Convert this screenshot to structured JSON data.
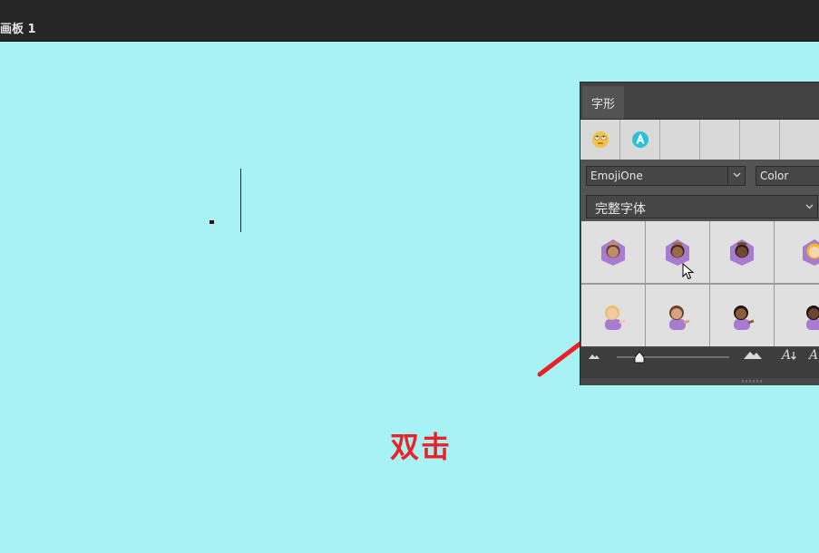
{
  "document": {
    "artboard_label": "画板 1"
  },
  "annotation": {
    "text": "双击",
    "color": "#e8242a"
  },
  "glyphs_panel": {
    "tab_label": "字形",
    "recent_glyphs": [
      "rolling-eyes-emoji",
      "letter-a-circle-emoji",
      "",
      "",
      ""
    ],
    "font_family": "EmojiOne",
    "font_style": "Color",
    "glyph_filter": "完整字体",
    "grid": [
      [
        "woman-gesturing-ok-medium-skin",
        "woman-gesturing-ok-medium-dark-skin",
        "woman-gesturing-ok-dark-skin",
        "woman-gesturing-ok-light-skin"
      ],
      [
        "woman-tipping-hand-light-skin",
        "woman-tipping-hand-medium-skin",
        "woman-tipping-hand-medium-dark-skin",
        "woman-tipping-hand-dark-skin"
      ]
    ],
    "selected_cell": "woman-gesturing-ok-medium-dark-skin",
    "glyph_size_level": 0.2
  }
}
